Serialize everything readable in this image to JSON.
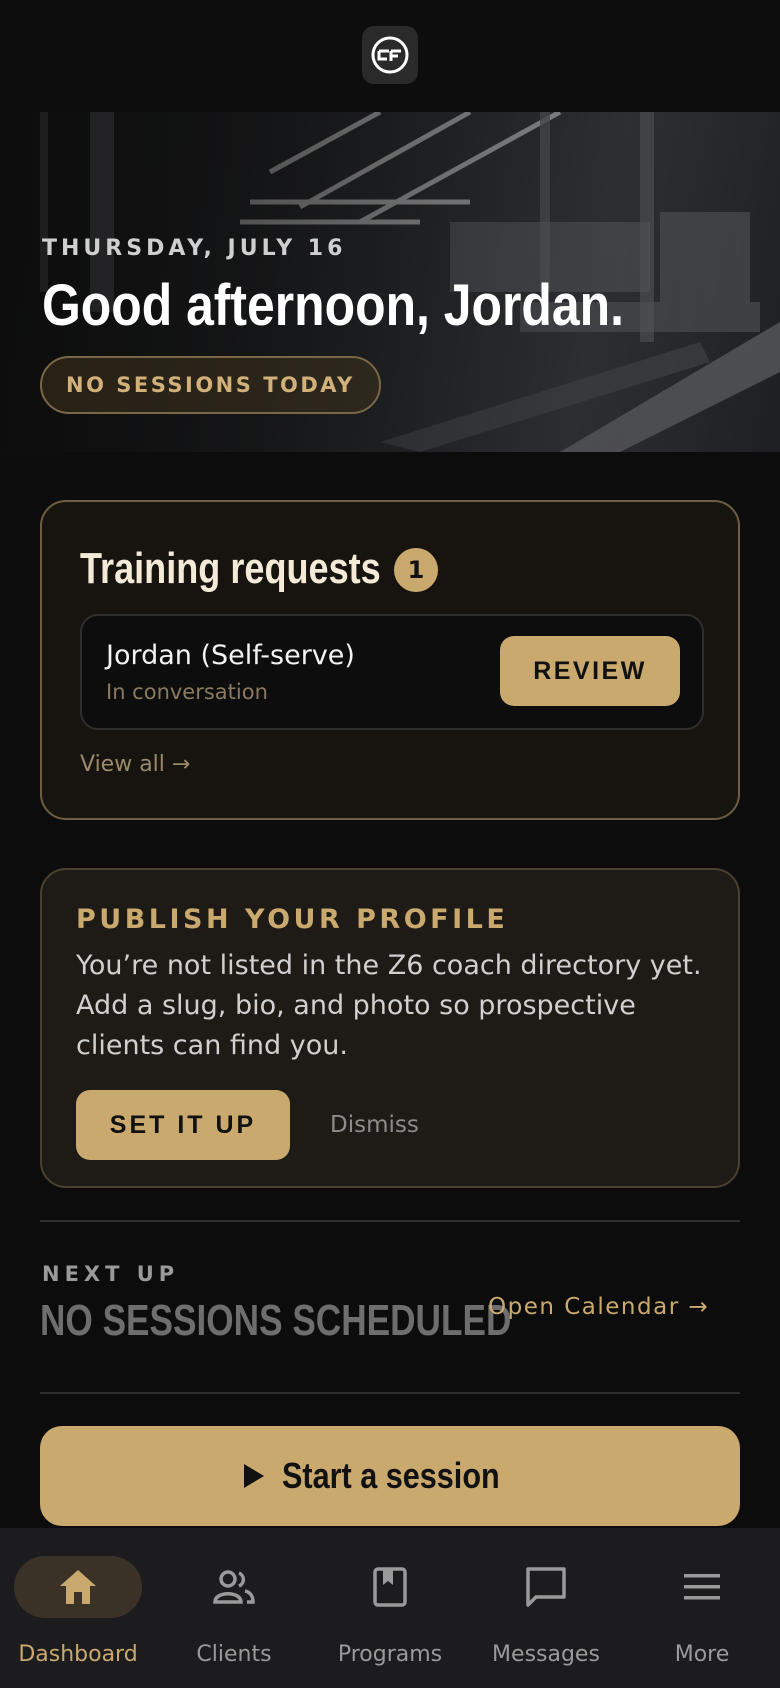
{
  "app": {
    "logo_icon": "brand-logo-icon"
  },
  "hero": {
    "date": "THURSDAY, JULY 16",
    "greeting": "Good afternoon, Jordan.",
    "status_pill": "NO SESSIONS TODAY"
  },
  "requests": {
    "title": "Training requests",
    "count": "1",
    "items": [
      {
        "name": "Jordan (Self-serve)",
        "status": "In conversation",
        "action": "REVIEW"
      }
    ],
    "view_all": "View all →"
  },
  "publish": {
    "title": "PUBLISH YOUR PROFILE",
    "body": "You’re not listed in the Z6 coach directory yet. Add a slug, bio, and photo so prospective clients can find you.",
    "primary": "SET IT UP",
    "secondary": "Dismiss"
  },
  "next_up": {
    "label": "NEXT UP",
    "value": "NO SESSIONS SCHEDULED",
    "link": "Open Calendar →"
  },
  "start_session": {
    "label": "Start a session",
    "icon": "play-icon"
  },
  "nav": {
    "items": [
      {
        "label": "Dashboard",
        "icon": "home-icon",
        "active": true
      },
      {
        "label": "Clients",
        "icon": "people-icon",
        "active": false
      },
      {
        "label": "Programs",
        "icon": "book-icon",
        "active": false
      },
      {
        "label": "Messages",
        "icon": "chat-icon",
        "active": false
      },
      {
        "label": "More",
        "icon": "menu-icon",
        "active": false
      }
    ]
  },
  "colors": {
    "accent": "#c9a96e",
    "background": "#0c0c0c",
    "nav_bg": "#1c1c1e"
  }
}
